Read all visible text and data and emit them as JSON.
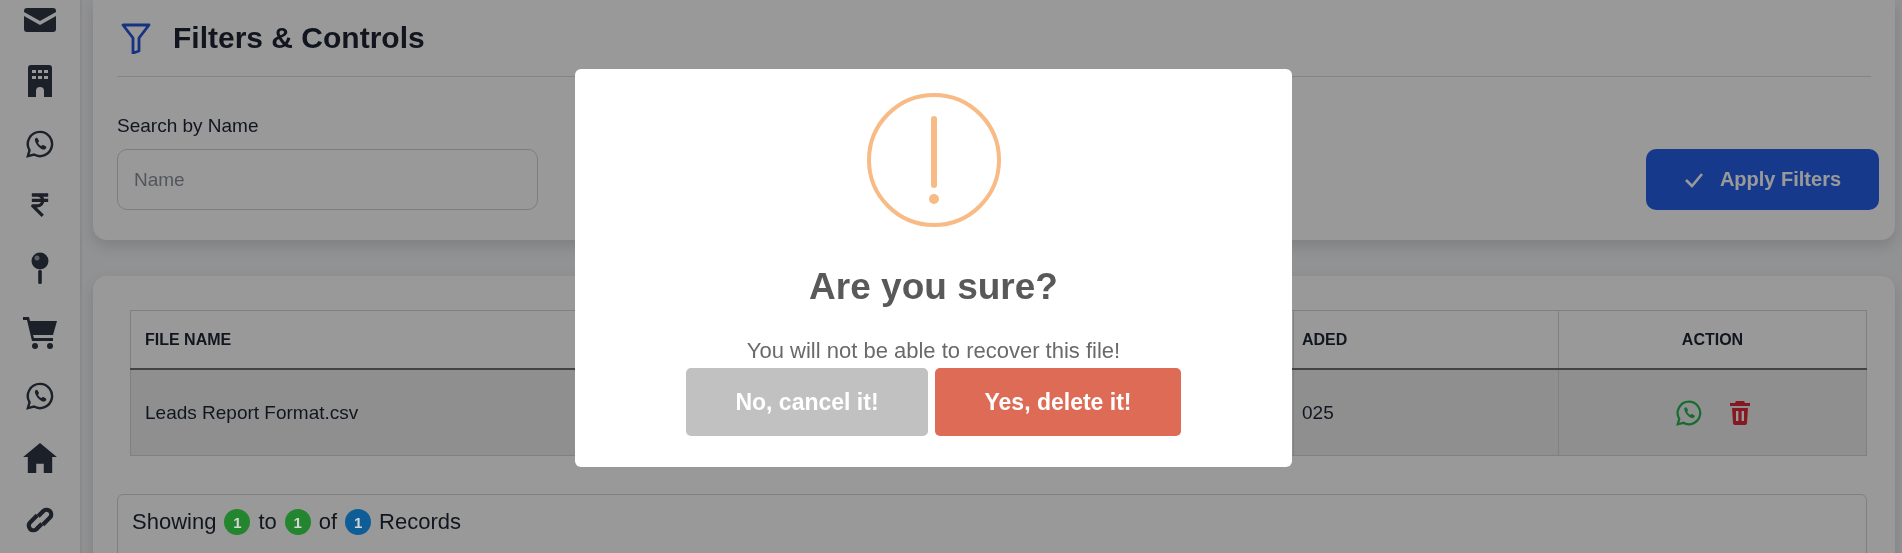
{
  "filters": {
    "title": "Filters & Controls",
    "search": {
      "label": "Search by Name",
      "placeholder": "Name"
    },
    "apply_button": "Apply Filters"
  },
  "table": {
    "columns": [
      "FILE NAME",
      "ADED",
      "ACTION"
    ],
    "rows": [
      {
        "cells": [
          "Leads Report Format.csv",
          "025"
        ]
      }
    ]
  },
  "pagination": [
    {
      "kind": "text",
      "text": "Showing"
    },
    {
      "kind": "badge",
      "text": "1",
      "color": "#23862e"
    },
    {
      "kind": "text",
      "text": "to"
    },
    {
      "kind": "badge",
      "text": "1",
      "color": "#23862e"
    },
    {
      "kind": "text",
      "text": "of"
    },
    {
      "kind": "badge",
      "text": "1",
      "color": "#0f5d96"
    },
    {
      "kind": "text",
      "text": "Records"
    }
  ],
  "dialog": {
    "title": "Are you sure?",
    "text": "You will not be able to recover this file!",
    "buttons": [
      {
        "label": "No, cancel it!",
        "kind": "cancel"
      },
      {
        "label": "Yes, delete it!",
        "kind": "confirm"
      }
    ]
  }
}
